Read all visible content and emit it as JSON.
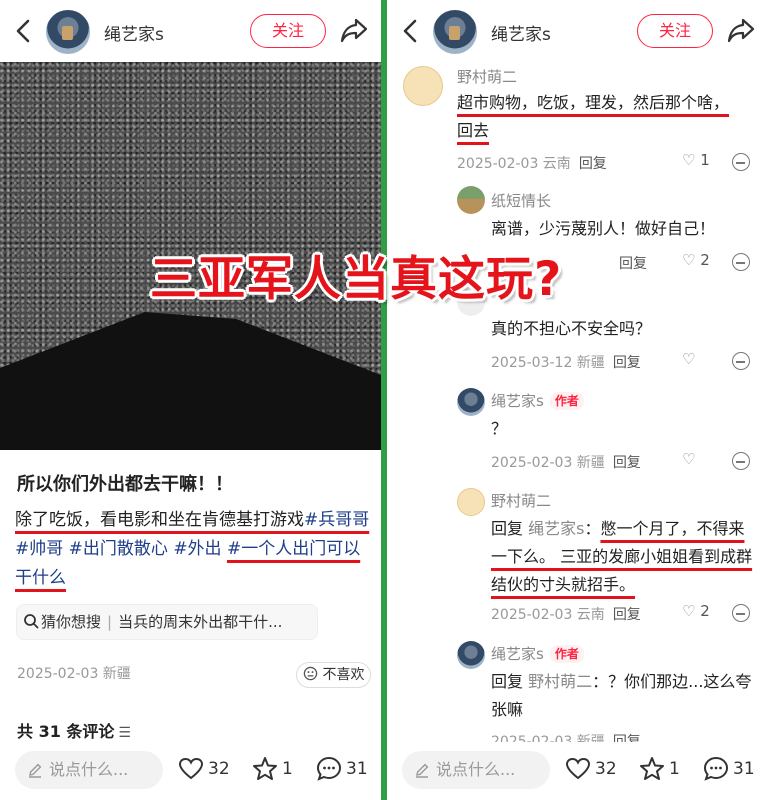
{
  "left": {
    "header": {
      "username": "绳艺家s",
      "follow_label": "关注"
    },
    "post": {
      "title": "所以你们外出都去干嘛！！",
      "body_text": "除了吃饭，看电影和坐在肯德基打游戏",
      "tags": [
        "#兵哥哥",
        "#帅哥",
        "#出门散散心",
        "#外出",
        "#一个人出门可以干什么"
      ],
      "suggest_label": "猜你想搜",
      "suggest_query": "当兵的周末外出都干什...",
      "meta": "2025-02-03 新疆",
      "dislike_label": "不喜欢",
      "comment_count_label": "共 31 条评论"
    },
    "bottom": {
      "say_placeholder": "说点什么...",
      "likes": "32",
      "stars": "1",
      "comments": "31"
    }
  },
  "right": {
    "header": {
      "username": "绳艺家s",
      "follow_label": "关注"
    },
    "comments": [
      {
        "name": "野村萌二",
        "text": "超市购物，吃饭，理发，然后那个啥，回去",
        "meta": "2025-02-03 云南",
        "reply": "回复",
        "likes": "1"
      },
      {
        "name": "纸短情长",
        "text": "离谱，少污蔑别人！做好自己！",
        "meta": "",
        "reply": "回复",
        "likes": "2"
      },
      {
        "name": "",
        "text": "真的不担心不安全吗？",
        "meta": "2025-03-12 新疆",
        "reply": "回复",
        "likes": ""
      },
      {
        "name": "绳艺家s",
        "author_badge": "作者",
        "text": "？",
        "meta": "2025-02-03 新疆",
        "reply": "回复",
        "likes": ""
      },
      {
        "name": "野村萌二",
        "reply_prefix": "回复",
        "reply_to": "绳艺家s",
        "text": "憋一个月了，不得来一下么。 三亚的发廊小姐姐看到成群结伙的寸头就招手。",
        "meta": "2025-02-03 云南",
        "reply": "回复",
        "likes": "2"
      },
      {
        "name": "绳艺家s",
        "author_badge": "作者",
        "reply_prefix": "回复",
        "reply_to": "野村萌二",
        "text": "？你们那边...这么夸张嘛",
        "meta": "2025-02-03 新疆",
        "reply": "回复",
        "likes": ""
      }
    ],
    "bottom": {
      "say_placeholder": "说点什么...",
      "likes": "32",
      "stars": "1",
      "comments": "31"
    }
  },
  "overlay": {
    "headline": "三亚军人当真这玩?"
  },
  "colors": {
    "accent": "#ff2442",
    "tag": "#1f3f8a",
    "underline": "#e1141e",
    "headline": "#e5141b",
    "frame": "#2f9e44"
  }
}
